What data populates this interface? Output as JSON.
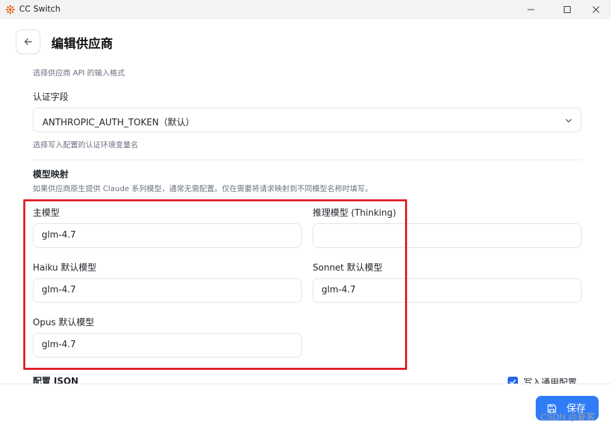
{
  "window": {
    "title": "CC Switch"
  },
  "header": {
    "title": "编辑供应商"
  },
  "api_format": {
    "hint": "选择供应商 API 的输入格式"
  },
  "auth": {
    "label": "认证字段",
    "selected": "ANTHROPIC_AUTH_TOKEN（默认）",
    "hint": "选择写入配置的认证环境变量名"
  },
  "model_mapping": {
    "title": "模型映射",
    "description": "如果供应商原生提供 Claude 系列模型，通常无需配置。仅在需要将请求映射到不同模型名称时填写。",
    "main_model": {
      "label": "主模型",
      "value": "glm-4.7"
    },
    "thinking_model": {
      "label": "推理模型 (Thinking)",
      "value": ""
    },
    "haiku_model": {
      "label": "Haiku 默认模型",
      "value": "glm-4.7"
    },
    "sonnet_model": {
      "label": "Sonnet 默认模型",
      "value": "glm-4.7"
    },
    "opus_model": {
      "label": "Opus 默认模型",
      "value": "glm-4.7"
    }
  },
  "config_json": {
    "label": "配置 JSON",
    "write_common_label": "写入通用配置",
    "write_common_checked": true
  },
  "footer": {
    "save_label": "保存",
    "watermark": "CSDN @夏客"
  },
  "colors": {
    "accent": "#2f7cf6",
    "highlight": "#e0202a"
  }
}
